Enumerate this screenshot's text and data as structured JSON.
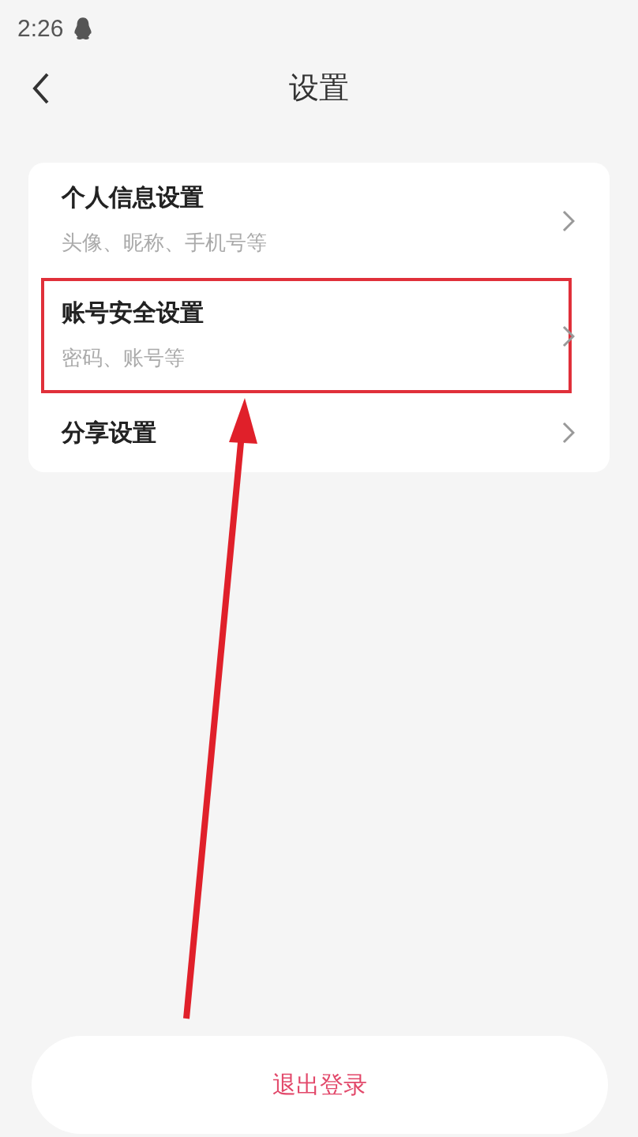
{
  "status_bar": {
    "time": "2:26"
  },
  "header": {
    "title": "设置"
  },
  "settings": [
    {
      "title": "个人信息设置",
      "subtitle": "头像、昵称、手机号等",
      "highlighted": false
    },
    {
      "title": "账号安全设置",
      "subtitle": "密码、账号等",
      "highlighted": true
    },
    {
      "title": "分享设置",
      "highlighted": false
    }
  ],
  "logout_button": {
    "label": "退出登录"
  }
}
